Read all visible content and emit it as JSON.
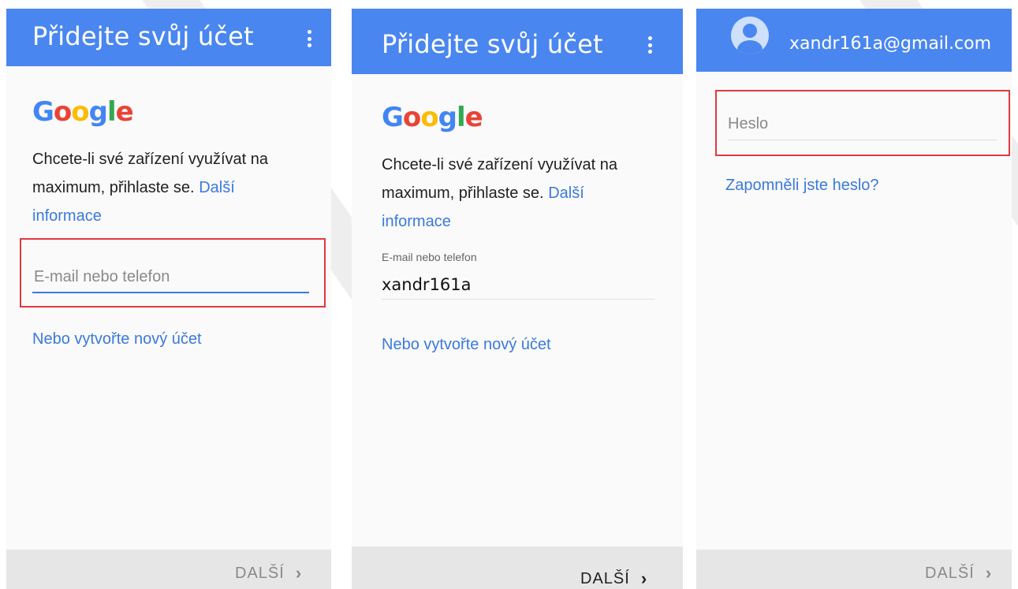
{
  "panels": [
    {
      "title": "Přidejte svůj účet",
      "logo": [
        "G",
        "o",
        "o",
        "g",
        "l",
        "e"
      ],
      "intro_text": "Chcete-li své zařízení využívat na maximum, přihlaste se.",
      "intro_link": "Další informace",
      "email_placeholder": "E-mail nebo telefon",
      "create_account": "Nebo vytvořte nový účet",
      "next_label": "DALŠÍ",
      "next_enabled": false
    },
    {
      "title": "Přidejte svůj účet",
      "logo": [
        "G",
        "o",
        "o",
        "g",
        "l",
        "e"
      ],
      "intro_text": "Chcete-li své zařízení využívat na maximum, přihlaste se.",
      "intro_link": "Další informace",
      "email_label": "E-mail nebo telefon",
      "email_value": "xandr161a",
      "create_account": "Nebo vytvořte nový účet",
      "next_label": "DALŠÍ",
      "next_enabled": true
    },
    {
      "account_email": "xandr161a@gmail.com",
      "password_placeholder": "Heslo",
      "forgot_password": "Zapomněli jste heslo?",
      "next_label": "DALŠÍ",
      "next_enabled": false
    }
  ],
  "icons": {
    "more_menu": "more-vertical-icon",
    "next_chevron": "chevron-right-icon",
    "avatar": "account-circle-icon"
  },
  "colors": {
    "app_bar": "#4a86f0",
    "link": "#3a79df",
    "highlight_box": "#e0393e",
    "footer": "#e6e6e6",
    "disabled_text": "#8a8a8a"
  }
}
